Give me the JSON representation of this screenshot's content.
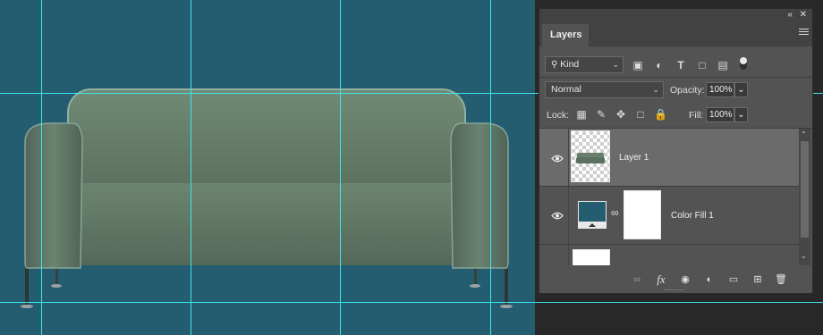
{
  "window_controls": {
    "collapse": "«",
    "close": "✕"
  },
  "panel": {
    "tab_label": "Layers",
    "filter": {
      "label": "Kind",
      "icon": "search-icon"
    },
    "blend_mode": "Normal",
    "opacity_label": "Opacity:",
    "opacity_value": "100%",
    "lock_label": "Lock:",
    "fill_label": "Fill:",
    "fill_value": "100%",
    "layers": [
      {
        "name": "Layer 1",
        "visible": true,
        "selected": true
      },
      {
        "name": "Color Fill 1",
        "visible": true,
        "selected": false
      }
    ]
  },
  "colors": {
    "canvas_fill": "#245c70",
    "guide": "#3ee6ec",
    "sofa": "#5e7562"
  }
}
